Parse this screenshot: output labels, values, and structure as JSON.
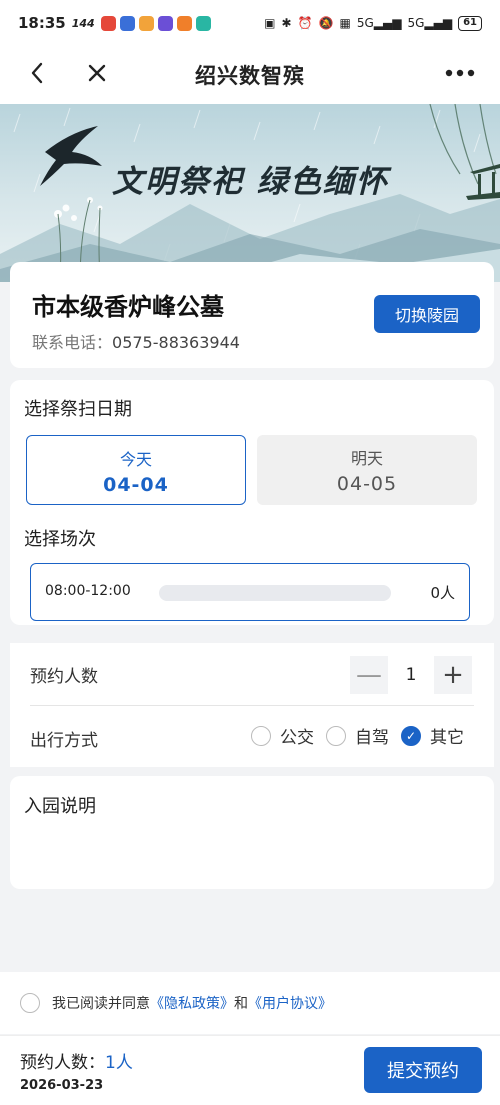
{
  "status_bar": {
    "time": "18:35",
    "network": "144",
    "battery": "61",
    "app_icon_colors": [
      "#e5483a",
      "#3a6fd8",
      "#f2a33a",
      "#6b4fd6",
      "#f07f2a",
      "#29b6a3"
    ],
    "signal_1": "5G",
    "signal_2": "5G"
  },
  "nav": {
    "title": "绍兴数智殡",
    "back_icon": "chevron-left-icon",
    "close_icon": "close-icon",
    "more_icon": "more-icon"
  },
  "banner": {
    "slogan": "文明祭祀  绿色缅怀"
  },
  "cemetery": {
    "name": "市本级香炉峰公墓",
    "phone_label": "联系电话：",
    "phone": "0575-88363944",
    "switch_label": "切换陵园"
  },
  "date_section": {
    "title": "选择祭扫日期",
    "options": [
      {
        "label": "今天",
        "date": "04-04",
        "selected": true
      },
      {
        "label": "明天",
        "date": "04-05",
        "selected": false
      }
    ]
  },
  "session_section": {
    "title": "选择场次",
    "sessions": [
      {
        "time": "08:00-12:00",
        "count": "0人",
        "fill_fraction": 0
      }
    ]
  },
  "booking": {
    "people_label": "预约人数",
    "people_value": "1",
    "minus": "—",
    "plus": "+",
    "travel_label": "出行方式",
    "travel_options": [
      {
        "label": "公交",
        "checked": false
      },
      {
        "label": "自驾",
        "checked": false
      },
      {
        "label": "其它",
        "checked": true
      }
    ]
  },
  "notice": {
    "title": "入园说明"
  },
  "agreement": {
    "prefix": "我已阅读并同意",
    "privacy": "《隐私政策》",
    "and": "和",
    "user": "《用户协议》"
  },
  "footer": {
    "count_label": "预约人数：",
    "count_value": "1人",
    "date": "2026-03-23",
    "submit_label": "提交预约"
  },
  "colors": {
    "accent": "#1b63c6",
    "background": "#f2f3f5"
  }
}
